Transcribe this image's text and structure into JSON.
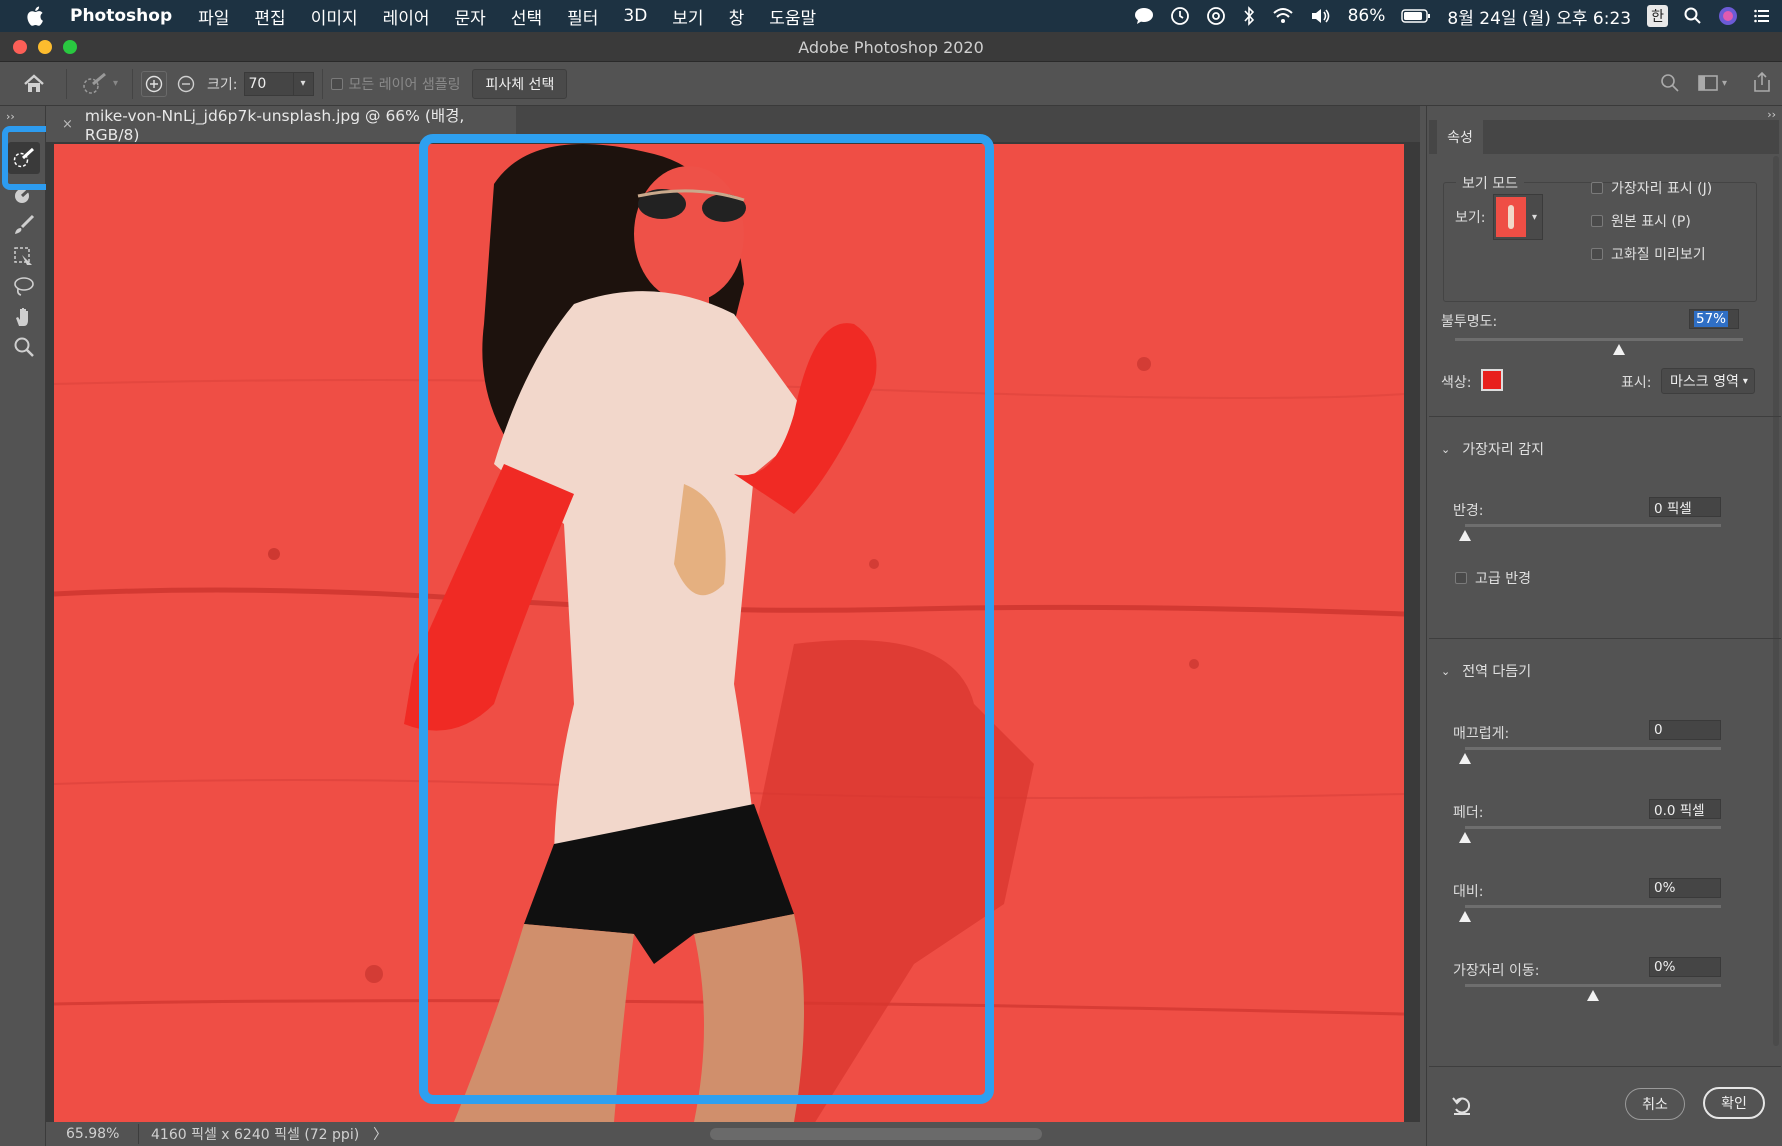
{
  "menubar": {
    "app_name": "Photoshop",
    "items": [
      "파일",
      "편집",
      "이미지",
      "레이어",
      "문자",
      "선택",
      "필터",
      "3D",
      "보기",
      "창",
      "도움말"
    ],
    "battery": "86%",
    "datetime": "8월 24일 (월) 오후 6:23",
    "ime": "한"
  },
  "window": {
    "title": "Adobe Photoshop 2020"
  },
  "options": {
    "size_label": "크기:",
    "size_value": "70",
    "sample_all_layers": "모든 레이어 샘플링",
    "select_subject": "피사체 선택"
  },
  "document": {
    "tab_title": "mike-von-NnLj_jd6p7k-unsplash.jpg @ 66% (배경, RGB/8)",
    "close": "×",
    "overlay_color": "#ef4e45"
  },
  "status": {
    "zoom": "65.98%",
    "doc_size": "4160 픽셀 x 6240 픽셀 (72 ppi)",
    "arrow": "〉"
  },
  "properties": {
    "tab_label": "속성",
    "view_mode": {
      "legend": "보기 모드",
      "view_label": "보기:",
      "show_edge": "가장자리 표시 (J)",
      "show_original": "원본 표시 (P)",
      "hq_preview": "고화질 미리보기"
    },
    "opacity_label": "불투명도:",
    "opacity_value": "57%",
    "opacity_level": 0.57,
    "color_label": "색상:",
    "color_value": "#e8201c",
    "display_label": "표시:",
    "display_value": "마스크 영역",
    "edge_detection": {
      "title": "가장자리 감지",
      "radius_label": "반경:",
      "radius_value": "0 픽셀",
      "smart_radius": "고급 반경"
    },
    "global_refinements": {
      "title": "전역 다듬기",
      "smooth_label": "매끄럽게:",
      "smooth_value": "0",
      "feather_label": "페더:",
      "feather_value": "0.0 픽셀",
      "contrast_label": "대비:",
      "contrast_value": "0%",
      "shift_edge_label": "가장자리 이동:",
      "shift_edge_value": "0%"
    },
    "cancel": "취소",
    "ok": "확인"
  },
  "accent_color": "#2d9cf0"
}
